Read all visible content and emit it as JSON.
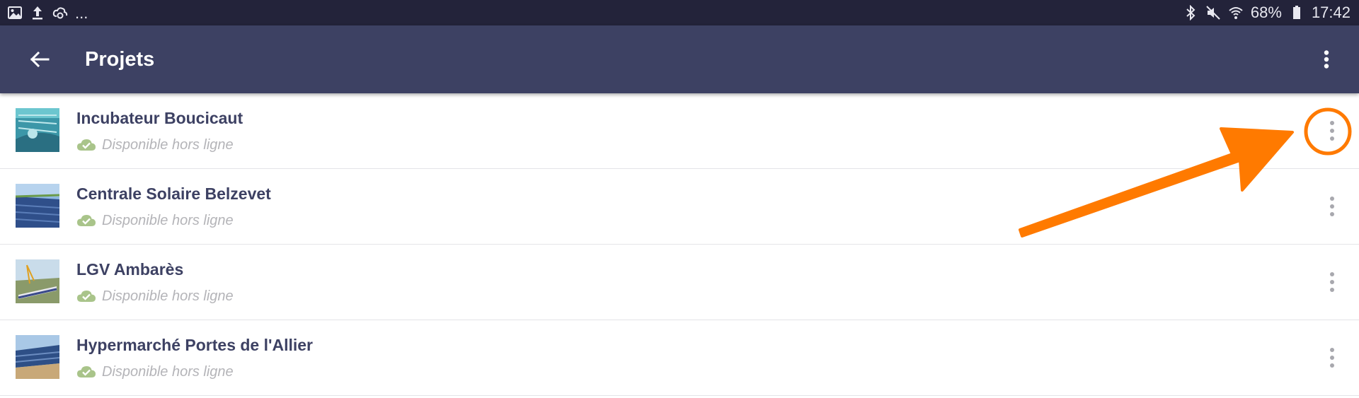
{
  "status_bar": {
    "overflow": "...",
    "battery_percent": "68%",
    "time": "17:42"
  },
  "app_bar": {
    "title": "Projets"
  },
  "projects": [
    {
      "name": "Incubateur Boucicaut",
      "status": "Disponible hors ligne"
    },
    {
      "name": "Centrale Solaire Belzevet",
      "status": "Disponible hors ligne"
    },
    {
      "name": "LGV Ambarès",
      "status": "Disponible hors ligne"
    },
    {
      "name": "Hypermarché Portes de l'Allier",
      "status": "Disponible hors ligne"
    }
  ],
  "colors": {
    "status_bar": "#23233a",
    "app_bar": "#3d4163",
    "title_text": "#3d4163",
    "offline_icon": "#a9c48a",
    "status_text": "#b4b4b8",
    "annotation": "#ff7a00"
  },
  "icons": {
    "back": "arrow-left-icon",
    "overflow": "more-vert-icon",
    "offline": "cloud-check-icon"
  }
}
